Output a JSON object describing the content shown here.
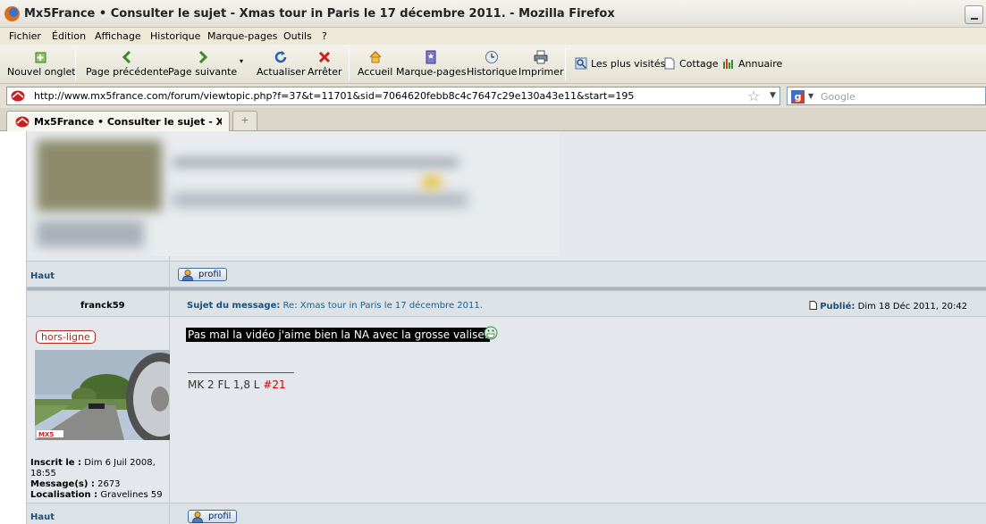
{
  "window": {
    "title": "Mx5France • Consulter le sujet - Xmas tour in Paris le 17 décembre 2011. - Mozilla Firefox"
  },
  "menu": [
    "Fichier",
    "Édition",
    "Affichage",
    "Historique",
    "Marque-pages",
    "Outils",
    "?"
  ],
  "toolbar": {
    "new_tab": "Nouvel onglet",
    "back": "Page précédente",
    "forward": "Page suivante",
    "reload": "Actualiser",
    "stop": "Arrêter",
    "home": "Accueil",
    "bookmarks": "Marque-pages",
    "history": "Historique",
    "print": "Imprimer"
  },
  "bookmarks_bar": [
    "Les plus visités",
    "Cottage",
    "Annuaire"
  ],
  "url_bar": {
    "url": "http://www.mx5france.com/forum/viewtopic.php?f=37&t=11701&sid=7064620febb8c4c7647c29e130a43e11&start=195"
  },
  "search": {
    "placeholder": "Google"
  },
  "tabs": [
    {
      "label": "Mx5France • Consulter le sujet - Xm"
    }
  ],
  "new_tab_label": "+",
  "posts": [
    {
      "haut": "Haut",
      "profil": "profil"
    },
    {
      "author": "franck59",
      "status": "hors-ligne",
      "subject_label": "Sujet du message:",
      "subject": "Re: Xmas tour in Paris le 17 décembre 2011.",
      "published_label": "Publié:",
      "published": "Dim 18 Déc 2011, 20:42",
      "message": "Pas mal la vidéo j'aime bien la NA avec la grosse valise.",
      "signature_text": "MK 2 FL 1,8 L",
      "signature_number": "#21",
      "registered_label": "Inscrit le :",
      "registered": "Dim 6 Juil 2008, 18:55",
      "messages_label": "Message(s) :",
      "messages": "2673",
      "location_label": "Localisation :",
      "location": "Gravelines 59",
      "haut": "Haut",
      "profil": "profil"
    }
  ]
}
